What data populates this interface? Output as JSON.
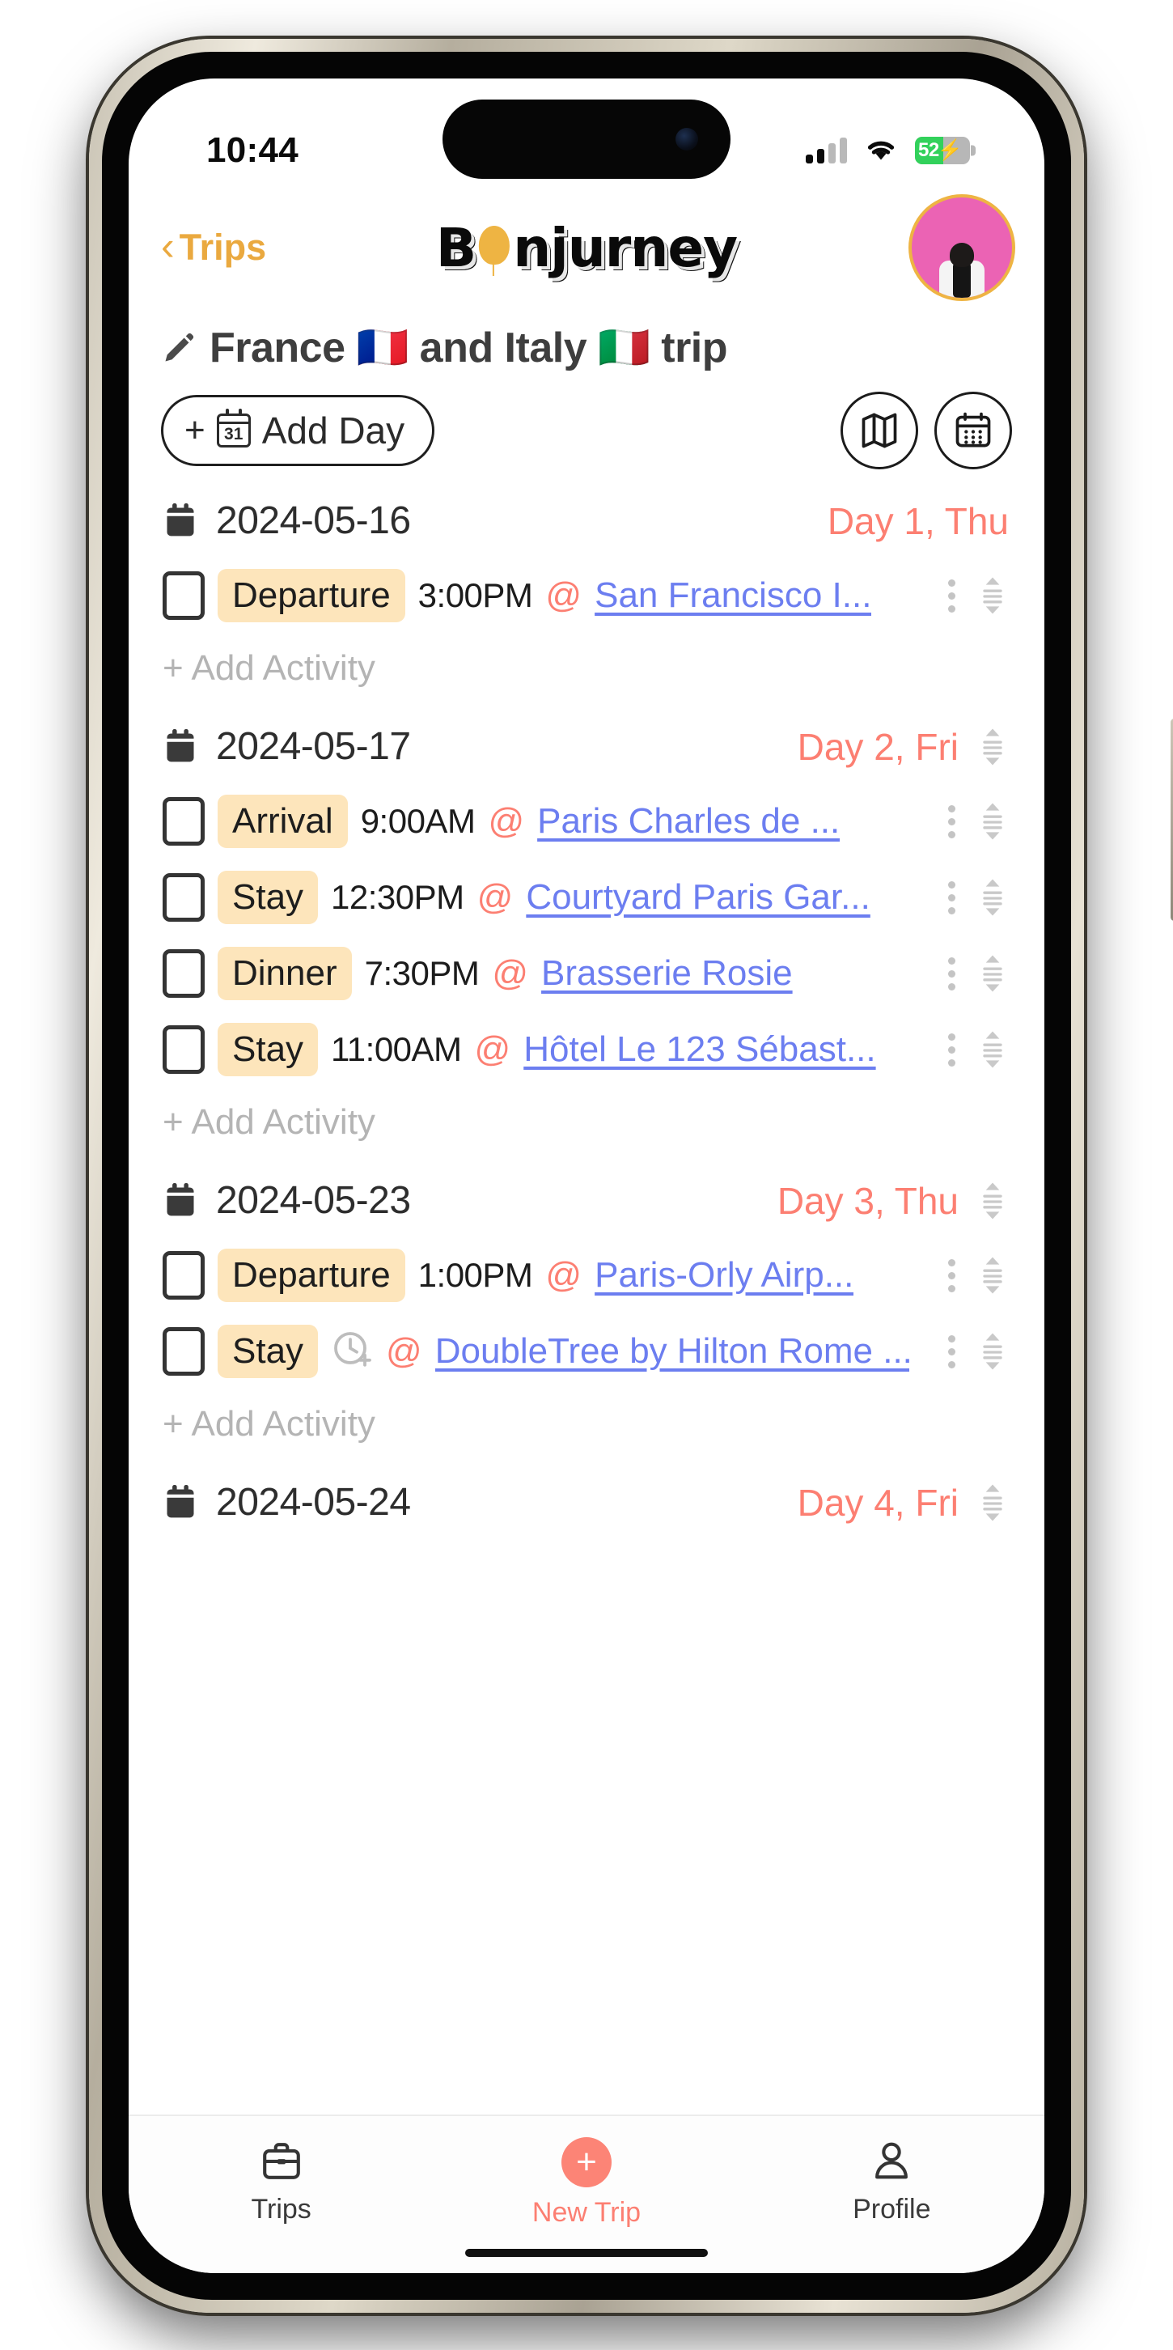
{
  "status_bar": {
    "time": "10:44",
    "signal_icon": "cellular-signal-icon",
    "wifi_icon": "wifi-icon",
    "battery_percent": "52",
    "battery_charging": true,
    "battery_color": "#32d15b"
  },
  "header": {
    "back_label": "Trips",
    "back_chevron": "‹",
    "brand_part1": "B",
    "brand_balloon": "o",
    "brand_part2": "njurney",
    "brand_color": "#0a0a0a",
    "accent_gold": "#eaa93f",
    "avatar_name": "user-avatar"
  },
  "trip": {
    "edit_icon": "pencil-icon",
    "title": "France 🇫🇷 and Italy 🇮🇹 trip"
  },
  "toolbar": {
    "add_day_plus": "+",
    "add_day_cal_number": "31",
    "add_day_label": "Add Day",
    "map_button": "map-view-button",
    "calendar_button": "calendar-view-button"
  },
  "accent_colors": {
    "coral": "#fc7f72",
    "badge_bg": "#fde5bb",
    "link_blue": "#6c7ef0",
    "muted_gray": "#b4b4b4"
  },
  "add_activity_label": "+ Add Activity",
  "days": [
    {
      "date": "2024-05-16",
      "day_label": "Day 1, Thu",
      "has_drag_handle": false,
      "activities": [
        {
          "type": "Departure",
          "time": "3:00PM",
          "at": "@",
          "place": "San Francisco I...",
          "has_time": true
        }
      ]
    },
    {
      "date": "2024-05-17",
      "day_label": "Day 2, Fri",
      "has_drag_handle": true,
      "activities": [
        {
          "type": "Arrival",
          "time": "9:00AM",
          "at": "@",
          "place": "Paris Charles de ...",
          "has_time": true
        },
        {
          "type": "Stay",
          "time": "12:30PM",
          "at": "@",
          "place": "Courtyard Paris Gar...",
          "has_time": true
        },
        {
          "type": "Dinner",
          "time": "7:30PM",
          "at": "@",
          "place": "Brasserie Rosie",
          "has_time": true
        },
        {
          "type": "Stay",
          "time": "11:00AM",
          "at": "@",
          "place": "Hôtel Le 123 Sébast...",
          "has_time": true
        }
      ]
    },
    {
      "date": "2024-05-23",
      "day_label": "Day 3, Thu",
      "has_drag_handle": true,
      "activities": [
        {
          "type": "Departure",
          "time": "1:00PM",
          "at": "@",
          "place": "Paris-Orly Airp...",
          "has_time": true
        },
        {
          "type": "Stay",
          "time": "",
          "at": "@",
          "place": "DoubleTree by Hilton Rome ...",
          "has_time": false,
          "time_icon": "clock-add-icon"
        }
      ]
    },
    {
      "date": "2024-05-24",
      "day_label": "Day 4, Fri",
      "has_drag_handle": true,
      "activities": []
    }
  ],
  "tab_bar": {
    "items": [
      {
        "label": "Trips",
        "icon": "briefcase-icon",
        "active": false
      },
      {
        "label": "New Trip",
        "icon": "plus-circle-icon",
        "active": true
      },
      {
        "label": "Profile",
        "icon": "person-icon",
        "active": false
      }
    ]
  }
}
